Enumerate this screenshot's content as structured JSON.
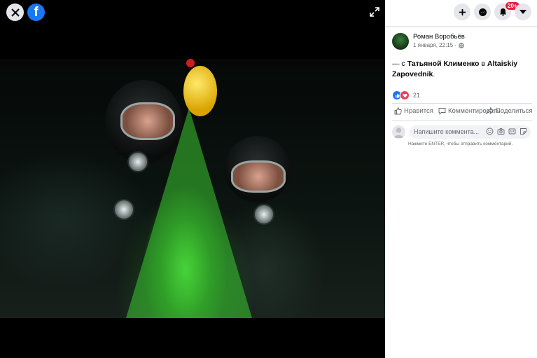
{
  "viewer": {
    "brand_letter": "f",
    "photo_alt": "Underwater photo of two divers next to a Christmas tree"
  },
  "topbar": {
    "notifications_badge": "20+"
  },
  "post": {
    "author": "Роман Воробьёв",
    "date": "1 января, 22:15 ·",
    "text_prefix": "— с ",
    "tagged_person": "Татьяной Клименко",
    "text_middle": " в ",
    "location": "Altaiskiy Zapovednik",
    "text_suffix": ".",
    "reaction_count": "21"
  },
  "actions": {
    "like": "Нравится",
    "comment": "Комментировать",
    "share": "Поделиться"
  },
  "comment_box": {
    "placeholder": "Напишите коммента...",
    "hint": "Нажмите ENTER, чтобы отправить комментарий."
  },
  "colors": {
    "accent": "#1877f2",
    "badge": "#e41e3f",
    "love": "#f33e58"
  }
}
